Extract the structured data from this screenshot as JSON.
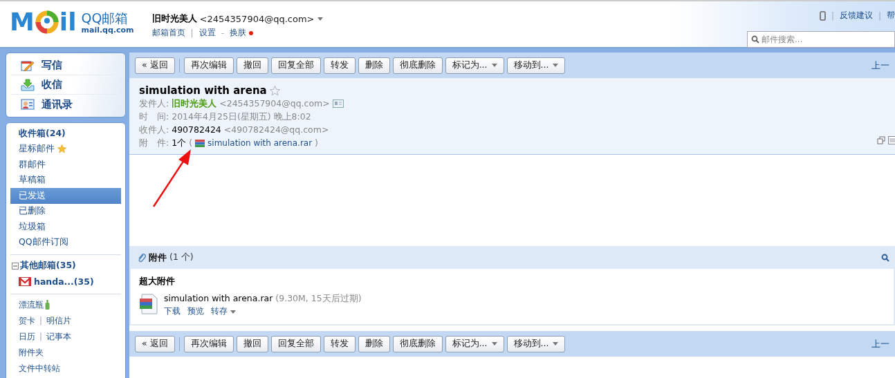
{
  "logo": {
    "left": "M",
    "right": "il",
    "name": "QQ邮箱",
    "domain": "mail.qq.com"
  },
  "account": {
    "name": "旧时光美人",
    "address": "<2454357904@qq.com>",
    "links": [
      {
        "label": "邮箱首页"
      },
      {
        "separator": "|",
        "label": "设置"
      },
      {
        "separator": "-",
        "label": "换肤",
        "dot": true
      }
    ]
  },
  "top_links": [
    {
      "separator": "|",
      "label": "反馈建议"
    },
    {
      "separator": "|",
      "label": "帮"
    }
  ],
  "search": {
    "placeholder": "邮件搜索..."
  },
  "quick_actions": [
    {
      "kind": "compose",
      "label": "写信"
    },
    {
      "kind": "inbox",
      "label": "收信"
    },
    {
      "kind": "contacts",
      "label": "通讯录"
    }
  ],
  "folders": [
    {
      "label": "收件箱(24)",
      "bold": true,
      "kind": "plain",
      "selected": false
    },
    {
      "label": "星标邮件",
      "bold": false,
      "kind": "star",
      "selected": false
    },
    {
      "label": "群邮件",
      "bold": false,
      "kind": "plain",
      "selected": false
    },
    {
      "label": "草稿箱",
      "bold": false,
      "kind": "plain",
      "selected": false
    },
    {
      "label": "已发送",
      "bold": false,
      "kind": "plain",
      "selected": true
    },
    {
      "label": "已删除",
      "bold": false,
      "kind": "plain",
      "selected": false
    },
    {
      "label": "垃圾箱",
      "bold": false,
      "kind": "plain",
      "selected": false
    },
    {
      "label": "QQ邮件订阅",
      "bold": false,
      "kind": "plain",
      "selected": false
    }
  ],
  "other_mailboxes": {
    "label": "其他邮箱(35)",
    "expanded": true,
    "children": [
      {
        "label": "handa...(35)",
        "kind": "gmail"
      }
    ]
  },
  "tools": [
    {
      "items": [
        {
          "label": "漂流瓶"
        }
      ],
      "kind": "bottle"
    },
    {
      "items": [
        {
          "label": "贺卡"
        },
        {
          "separator": "|",
          "label": "明信片"
        }
      ],
      "kind": "plain"
    },
    {
      "items": [
        {
          "label": "日历"
        },
        {
          "separator": "|",
          "label": "记事本"
        }
      ],
      "kind": "plain"
    },
    {
      "items": [
        {
          "label": "附件夹"
        }
      ],
      "kind": "plain"
    },
    {
      "items": [
        {
          "label": "文件中转站"
        }
      ],
      "kind": "plain"
    }
  ],
  "toolbar_top": {
    "buttons": [
      {
        "label": "« 返回",
        "dropdown": false
      },
      {
        "label": "再次编辑",
        "dropdown": false
      },
      {
        "label": "撤回",
        "dropdown": false
      },
      {
        "label": "回复全部",
        "dropdown": false
      },
      {
        "label": "转发",
        "dropdown": false
      },
      {
        "label": "删除",
        "dropdown": false
      },
      {
        "label": "彻底删除",
        "dropdown": false
      },
      {
        "label": "标记为...",
        "dropdown": true
      },
      {
        "label": "移动到...",
        "dropdown": true
      }
    ],
    "nav": "上一"
  },
  "mail": {
    "subject": "simulation with arena",
    "starred": false,
    "from": {
      "label": "发件人:",
      "name": "旧时光美人",
      "address": "<2454357904@qq.com>"
    },
    "time": {
      "label": "时　间:",
      "value": "2014年4月25日(星期五) 晚上8:02"
    },
    "to": {
      "label": "收件人:",
      "name": "490782424",
      "address": "<490782424@qq.com>"
    },
    "attachment": {
      "label": "附　件:",
      "count": "1个",
      "open": "(",
      "file": "simulation with arena.rar",
      "close": ")"
    }
  },
  "attachments": {
    "title": "附件",
    "count": "(1 个)",
    "group": "超大附件",
    "files": [
      {
        "name": "simulation with arena.rar",
        "meta": "(9.30M, 15天后过期)",
        "actions": [
          {
            "label": "下载",
            "dropdown": false
          },
          {
            "label": "预览",
            "dropdown": false
          },
          {
            "label": "转存",
            "dropdown": true
          }
        ]
      }
    ]
  },
  "toolbar_bottom": {
    "buttons": [
      {
        "label": "« 返回",
        "dropdown": false
      },
      {
        "label": "再次编辑",
        "dropdown": false
      },
      {
        "label": "撤回",
        "dropdown": false
      },
      {
        "label": "回复全部",
        "dropdown": false
      },
      {
        "label": "转发",
        "dropdown": false
      },
      {
        "label": "删除",
        "dropdown": false
      },
      {
        "label": "彻底删除",
        "dropdown": false
      },
      {
        "label": "标记为...",
        "dropdown": true
      },
      {
        "label": "移动到...",
        "dropdown": true
      }
    ],
    "nav": "上一"
  },
  "overlay": {
    "kind": "arrow"
  }
}
